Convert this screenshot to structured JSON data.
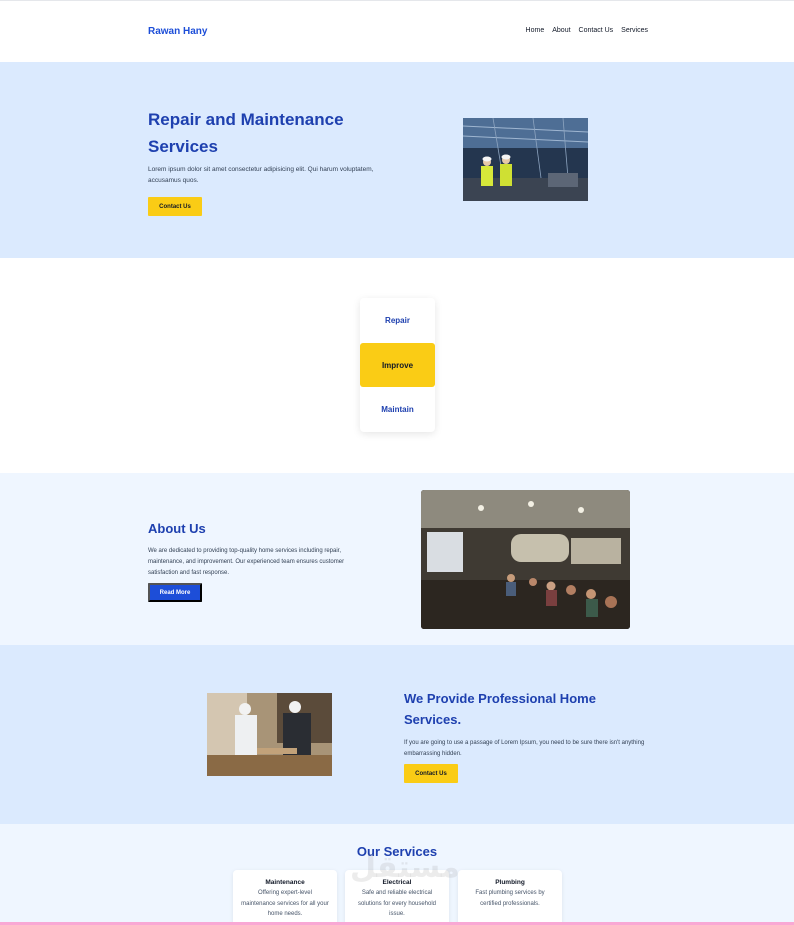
{
  "header": {
    "brand": "Rawan Hany",
    "nav": [
      "Home",
      "About",
      "Contact Us",
      "Services"
    ]
  },
  "hero": {
    "title": "Repair and Maintenance Services",
    "text": "Lorem ipsum dolor sit amet consectetur adipisicing elit. Qui harum voluptatem, accusamus quos.",
    "button": "Contact Us"
  },
  "tabs": {
    "items": [
      "Repair",
      "Improve",
      "Maintain"
    ],
    "active": "Improve"
  },
  "about": {
    "title": "About Us",
    "text": "We are dedicated to providing top-quality home services including repair, maintenance, and improvement. Our experienced team ensures customer satisfaction and fast response.",
    "button": "Read More"
  },
  "provide": {
    "title": "We Provide Professional Home Services.",
    "text": "If you are going to use a passage of Lorem Ipsum, you need to be sure there isn't anything embarrassing hidden.",
    "button": "Contact Us"
  },
  "services": {
    "title": "Our Services",
    "items": [
      {
        "name": "Maintenance",
        "desc": "Offering expert-level maintenance services for all your home needs."
      },
      {
        "name": "Electrical",
        "desc": "Safe and reliable electrical solutions for every household issue."
      },
      {
        "name": "Plumbing",
        "desc": "Fast plumbing services by certified professionals."
      }
    ]
  },
  "watermark": "مستقل",
  "colors": {
    "primary": "#1e40af",
    "accent": "#facc15",
    "hero_bg": "#dbeafe",
    "section_bg": "#eff6ff"
  }
}
